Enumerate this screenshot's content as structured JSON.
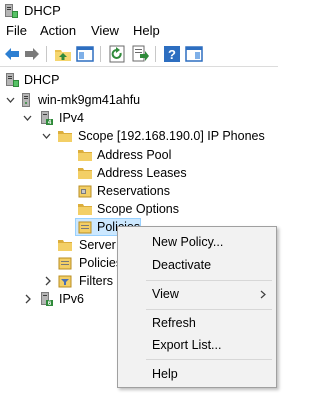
{
  "window": {
    "title": "DHCP"
  },
  "menubar": {
    "items": [
      "File",
      "Action",
      "View",
      "Help"
    ]
  },
  "toolbar": {
    "buttons": [
      "back-arrow-icon",
      "forward-arrow-icon",
      "up-folder-icon",
      "show-hide-tree-icon",
      "refresh-icon",
      "export-list-icon",
      "help-icon",
      "properties-icon"
    ]
  },
  "tree": {
    "root": "DHCP",
    "server": "win-mk9gm41ahfu",
    "ipv4": "IPv4",
    "scope": "Scope [192.168.190.0] IP Phones",
    "address_pool": "Address Pool",
    "address_leases": "Address Leases",
    "reservations": "Reservations",
    "scope_options": "Scope Options",
    "policies_scope": "Policies",
    "server_options": "Server O",
    "policies_server": "Policies",
    "filters": "Filters",
    "ipv6": "IPv6"
  },
  "context_menu": {
    "new_policy": "New Policy...",
    "deactivate": "Deactivate",
    "view": "View",
    "refresh": "Refresh",
    "export_list": "Export List...",
    "help": "Help"
  },
  "colors": {
    "selection": "#cce8ff",
    "selection_border": "#99d1ff",
    "menu_bg": "#f2f2f2",
    "accent": "#1e7ad6"
  }
}
